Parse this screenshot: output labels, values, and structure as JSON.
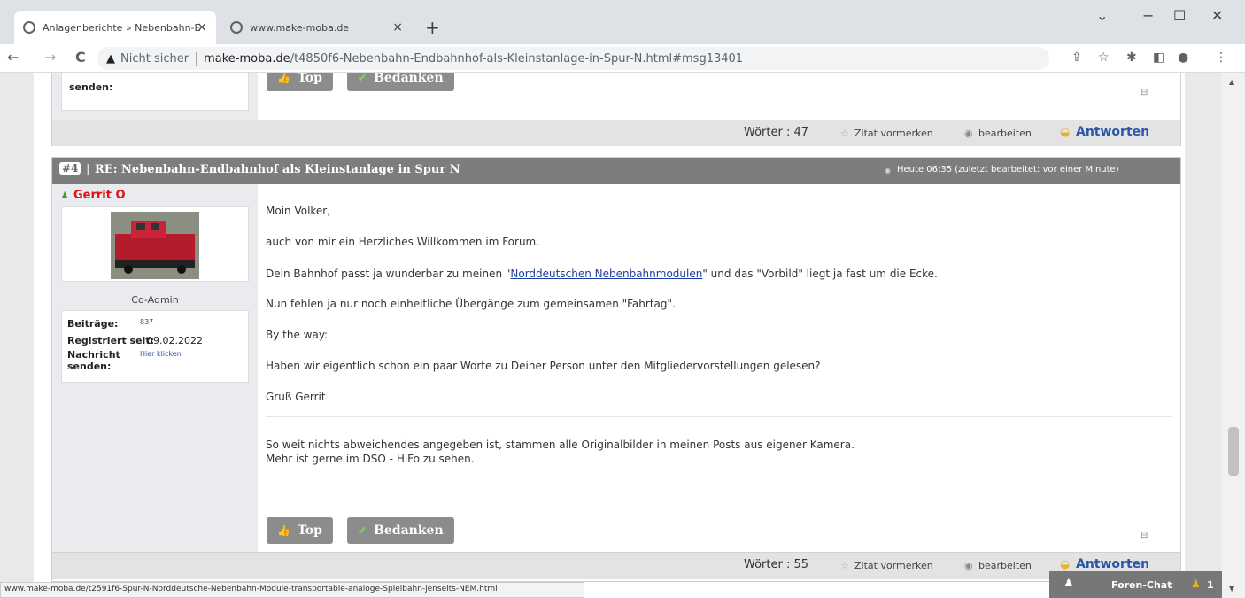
{
  "browser": {
    "tabs": [
      {
        "title": "Anlagenberichte » Nebenbahn-E",
        "close": "×"
      },
      {
        "title": "www.make-moba.de",
        "close": "×"
      }
    ],
    "new_tab": "+",
    "window_controls": [
      "⌄",
      "−",
      "☐",
      "✕"
    ],
    "nav": {
      "back": "←",
      "forward": "→",
      "reload": "C"
    },
    "address": {
      "security": "Nicht sicher",
      "host": "make-moba.de",
      "path": "/t4850f6-Nebenbahn-Endbahnhof-als-Kleinstanlage-in-Spur-N.html#msg13401"
    },
    "status_url": "www.make-moba.de/t2591f6-Spur-N-Norddeutsche-Nebenbahn-Module-transportable-analoge-Spielbahn-jenseits-NEM.html"
  },
  "prev_post": {
    "sidebar_label": "senden:",
    "top": "Top",
    "thanks": "Bedanken",
    "words": "Wörter : 47",
    "quote": "Zitat vormerken",
    "edit": "bearbeiten",
    "reply": "Antworten"
  },
  "post": {
    "number": "#4",
    "title": "RE: Nebenbahn-Endbahnhof als Kleinstanlage in Spur N",
    "date": "Heute 06:35 (zuletzt bearbeitet: vor einer Minute)",
    "author": "Gerrit O",
    "role": "Co-Admin",
    "stats": {
      "posts_label": "Beiträge:",
      "posts_value": "837",
      "registered_label": "Registriert seit:",
      "registered_value": "09.02.2022",
      "message_label": "Nachricht senden:",
      "message_value": "Hier klicken"
    },
    "greeting": "Moin Volker,",
    "line1": "auch von mir ein Herzliches Willkommen im Forum.",
    "line2_pre": "Dein Bahnhof passt ja wunderbar zu meinen \"",
    "line2_link": "Norddeutschen Nebenbahnmodulen",
    "line2_post": "\" und das \"Vorbild\" liegt ja fast um die Ecke.",
    "line3": "Nun fehlen ja nur noch einheitliche Übergänge zum gemeinsamen \"Fahrtag\".",
    "line4": "By the way:",
    "line5": "Haben wir eigentlich schon ein paar Worte zu Deiner Person unter den Mitgliedervorstellungen gelesen?",
    "signoff": "Gruß Gerrit",
    "sig1": "So weit nichts abweichendes angegeben ist, stammen alle Originalbilder in meinen Posts aus eigener Kamera.",
    "sig2": "Mehr ist gerne im DSO - HiFo zu sehen.",
    "top": "Top",
    "thanks": "Bedanken",
    "words": "Wörter : 55",
    "quote": "Zitat vormerken",
    "edit": "bearbeiten",
    "reply": "Antworten"
  },
  "chat": {
    "label": "Foren-Chat",
    "count": "1"
  }
}
